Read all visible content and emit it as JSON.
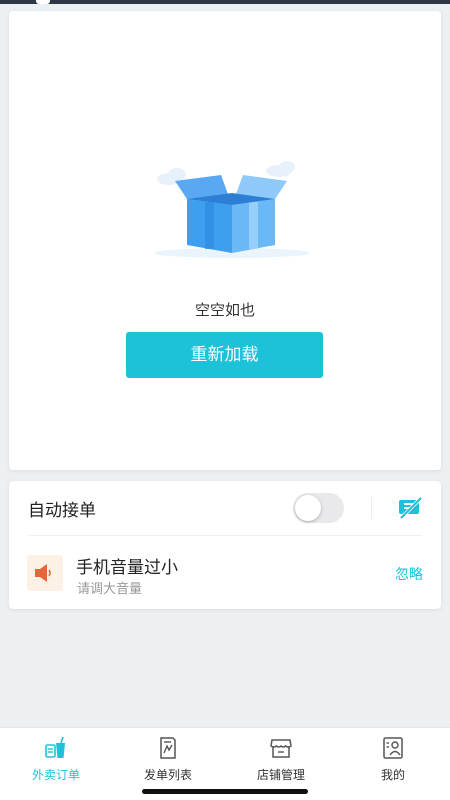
{
  "empty_state": {
    "message": "空空如也",
    "reload_label": "重新加载"
  },
  "auto_accept": {
    "label": "自动接单",
    "enabled": false
  },
  "volume_alert": {
    "title": "手机音量过小",
    "subtitle": "请调大音量",
    "ignore_label": "忽略"
  },
  "bottom_nav": {
    "items": [
      {
        "label": "外卖订单",
        "icon": "takeout-icon",
        "active": true
      },
      {
        "label": "发单列表",
        "icon": "order-list-icon",
        "active": false
      },
      {
        "label": "店铺管理",
        "icon": "store-icon",
        "active": false
      },
      {
        "label": "我的",
        "icon": "profile-icon",
        "active": false
      }
    ]
  },
  "colors": {
    "accent": "#1dc2d9",
    "background": "#edf0f3",
    "warning": "#e8643a"
  }
}
